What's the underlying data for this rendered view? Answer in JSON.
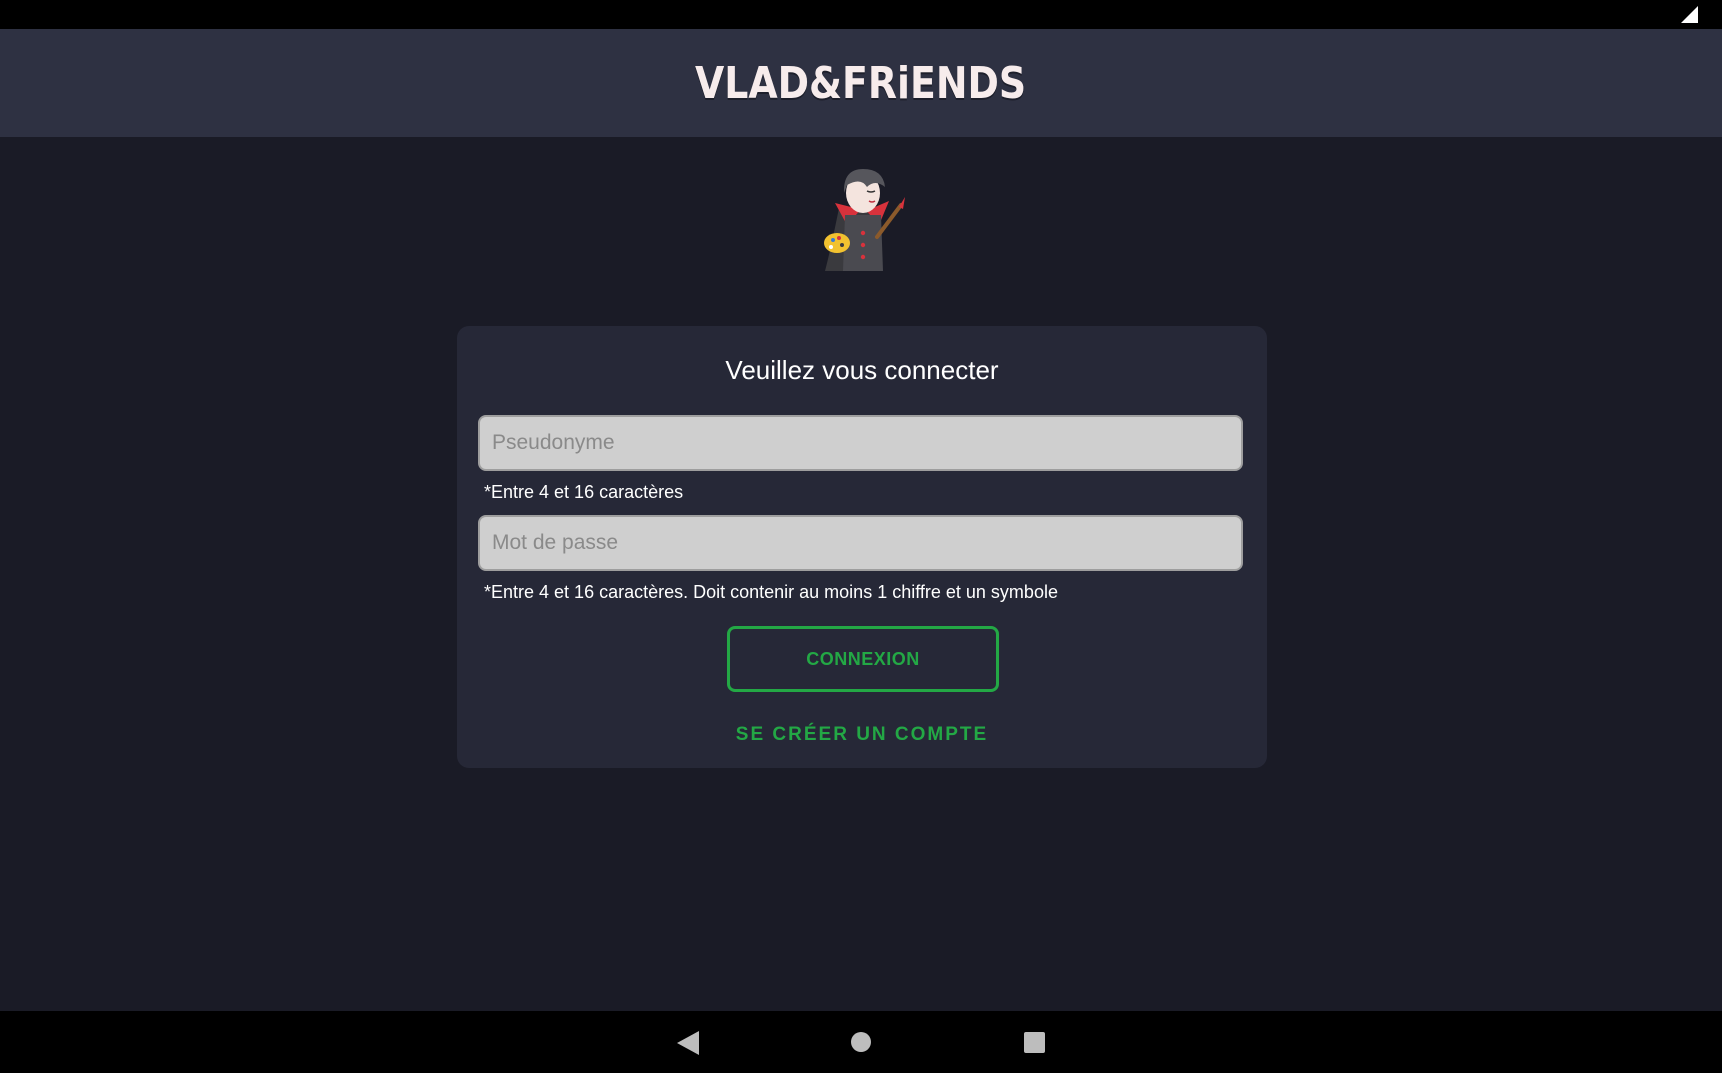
{
  "status_bar": {
    "signal_icon": "cellular-signal-icon"
  },
  "header": {
    "logo_text": "VLAD&FRiENDS"
  },
  "mascot": {
    "icon": "vampire-painter-mascot"
  },
  "login_card": {
    "title": "Veuillez vous connecter",
    "username": {
      "placeholder": "Pseudonyme",
      "value": "",
      "hint": "*Entre 4 et 16 caractères"
    },
    "password": {
      "placeholder": "Mot de passe",
      "value": "",
      "hint": "*Entre 4 et 16 caractères. Doit contenir au moins 1 chiffre et un symbole"
    },
    "login_button_label": "CONNEXION",
    "signup_link_label": "SE CRÉER UN COMPTE"
  },
  "nav_bar": {
    "back_icon": "back-triangle-icon",
    "home_icon": "home-circle-icon",
    "recents_icon": "recents-square-icon"
  },
  "colors": {
    "background": "#1a1b26",
    "header": "#2e3142",
    "card": "#262837",
    "accent_green": "#23a845",
    "field_bg": "#cfcfcf"
  }
}
